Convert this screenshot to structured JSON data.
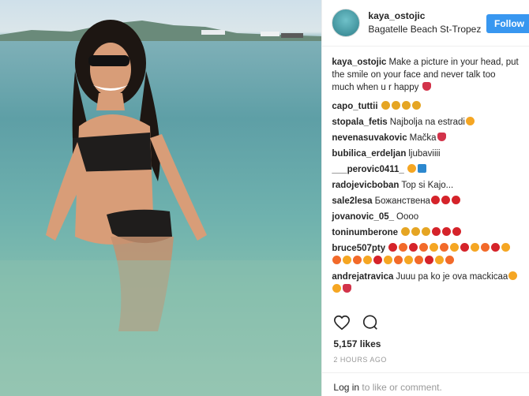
{
  "post": {
    "username": "kaya_ostojic",
    "location": "Bagatelle Beach St-Tropez",
    "follow_label": "Follow",
    "caption_user": "kaya_ostojic",
    "caption_text": "Make a picture in your head, put the smile on your face and never talk too much when u r happy"
  },
  "comments": [
    {
      "user": "capo_tuttii",
      "text": "",
      "emojis": [
        "gold",
        "gold",
        "gold",
        "gold"
      ]
    },
    {
      "user": "stopala_fetis",
      "text": "Najbolja na estradi",
      "emojis": [
        "orange"
      ]
    },
    {
      "user": "nevenasuvakovic",
      "text": "Mačka",
      "emojis": [
        "heart"
      ]
    },
    {
      "user": "bubilica_erdeljan",
      "text": "ljubaviiii",
      "emojis": []
    },
    {
      "user": "___perovic0411_",
      "text": "",
      "emojis": [
        "orange",
        "blue"
      ]
    },
    {
      "user": "radojevicboban",
      "text": "Top si Kajo...",
      "emojis": []
    },
    {
      "user": "sale2lesa",
      "text": "Божанствена",
      "emojis": [
        "red",
        "red",
        "red"
      ]
    },
    {
      "user": "jovanovic_05_",
      "text": "Oooo",
      "emojis": []
    },
    {
      "user": "toninumberone",
      "text": "",
      "emojis": [
        "gold",
        "gold",
        "gold",
        "red",
        "red",
        "red"
      ]
    },
    {
      "user": "bruce507pty",
      "text": "",
      "emojis": [
        "red",
        "fire",
        "red",
        "fire",
        "orange",
        "fire",
        "orange",
        "red",
        "orange",
        "fire",
        "red",
        "orange",
        "fire",
        "orange",
        "fire",
        "orange",
        "red",
        "orange",
        "fire",
        "orange",
        "fire",
        "red",
        "orange",
        "fire"
      ]
    },
    {
      "user": "andrejatravica",
      "text": "Juuu pa ko je ova mackicaa",
      "emojis": [
        "orange",
        "orange",
        "heart"
      ]
    }
  ],
  "actions": {
    "likes": "5,157 likes",
    "time": "2 HOURS AGO"
  },
  "footer": {
    "login_link": "Log in",
    "login_rest": " to like or comment."
  }
}
